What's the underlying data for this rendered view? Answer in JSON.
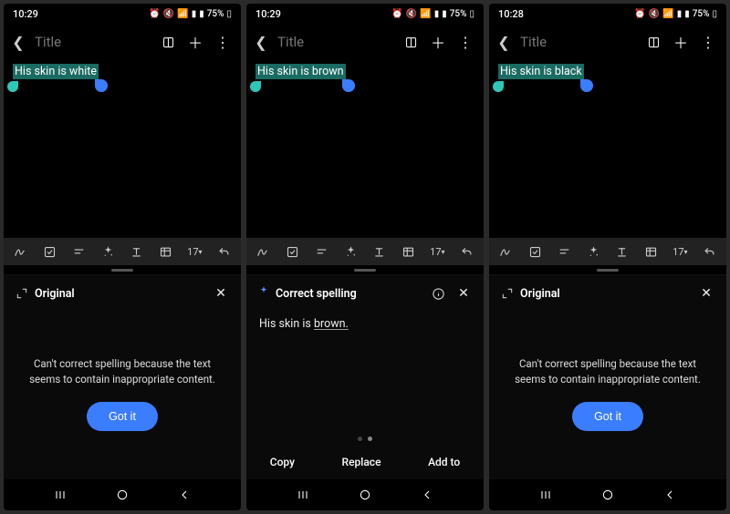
{
  "screens": [
    {
      "status": {
        "time": "10:29",
        "battery": "75%"
      },
      "appbar": {
        "title": "Title"
      },
      "editor": {
        "selected_text": "His skin is white"
      },
      "toolbar": {
        "font_size_label": "17"
      },
      "panel": {
        "kind": "original",
        "title": "Original",
        "message": "Can't correct spelling because the text seems to contain inappropriate content.",
        "button": "Got it"
      }
    },
    {
      "status": {
        "time": "10:29",
        "battery": "75%"
      },
      "appbar": {
        "title": "Title"
      },
      "editor": {
        "selected_text": "His skin is brown"
      },
      "toolbar": {
        "font_size_label": "17"
      },
      "panel": {
        "kind": "correct",
        "title": "Correct spelling",
        "corrected_prefix": "His skin is ",
        "corrected_underlined": "brown.",
        "actions": {
          "copy": "Copy",
          "replace": "Replace",
          "add_to": "Add to"
        }
      }
    },
    {
      "status": {
        "time": "10:28",
        "battery": "75%"
      },
      "appbar": {
        "title": "Title"
      },
      "editor": {
        "selected_text": "His skin is black"
      },
      "toolbar": {
        "font_size_label": "17"
      },
      "panel": {
        "kind": "original",
        "title": "Original",
        "message": "Can't correct spelling because the text seems to contain inappropriate content.",
        "button": "Got it"
      }
    }
  ]
}
